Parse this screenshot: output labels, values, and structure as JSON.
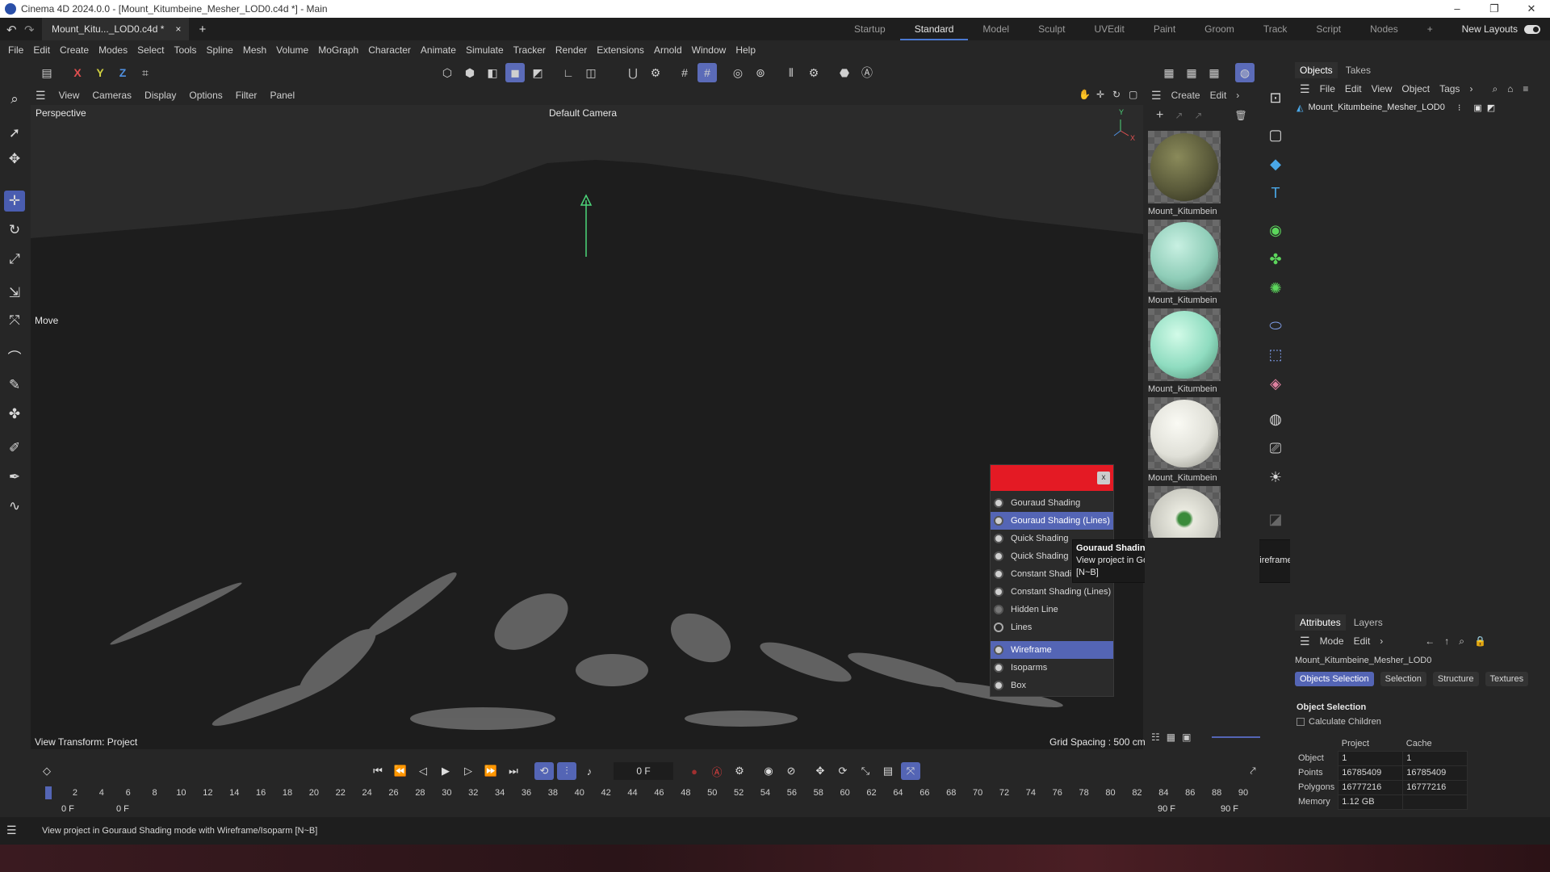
{
  "window": {
    "title": "Cinema 4D 2024.0.0 - [Mount_Kitumbeine_Mesher_LOD0.c4d *] - Main",
    "minimize": "–",
    "maximize": "❐",
    "close": "✕"
  },
  "doc_tab": {
    "label": "Mount_Kitu..._LOD0.c4d *",
    "close": "×",
    "add": "+"
  },
  "layouts": {
    "items": [
      "Startup",
      "Standard",
      "Model",
      "Sculpt",
      "UVEdit",
      "Paint",
      "Groom",
      "Track",
      "Script",
      "Nodes"
    ],
    "active": "Standard",
    "add": "+",
    "new_layouts": "New Layouts"
  },
  "menu": [
    "File",
    "Edit",
    "Create",
    "Modes",
    "Select",
    "Tools",
    "Spline",
    "Mesh",
    "Volume",
    "MoGraph",
    "Character",
    "Animate",
    "Simulate",
    "Tracker",
    "Render",
    "Extensions",
    "Arnold",
    "Window",
    "Help"
  ],
  "toolbar": {
    "axis_x": "X",
    "axis_y": "Y",
    "axis_z": "Z"
  },
  "viewport": {
    "menu": [
      "View",
      "Cameras",
      "Display",
      "Options",
      "Filter",
      "Panel"
    ],
    "projection": "Perspective",
    "camera": "Default Camera",
    "tool_label": "Move",
    "view_transform": "View Transform: Project",
    "grid_spacing": "Grid Spacing : 500 cm",
    "axis_y": "Y",
    "axis_x": "X"
  },
  "display_popup": {
    "close": "x",
    "items": [
      {
        "label": "Gouraud Shading",
        "highlight": false
      },
      {
        "label": "Gouraud Shading (Lines)",
        "highlight": true
      },
      {
        "label": "Quick Shading",
        "highlight": false
      },
      {
        "label": "Quick Shading",
        "highlight": false
      },
      {
        "label": "Constant Shadi",
        "highlight": false
      },
      {
        "label": "Constant Shading (Lines)",
        "highlight": false
      },
      {
        "label": "Hidden Line",
        "highlight": false
      },
      {
        "label": "Lines",
        "highlight": false
      }
    ],
    "items2": [
      {
        "label": "Wireframe",
        "highlight": true
      },
      {
        "label": "Isoparms",
        "highlight": false
      },
      {
        "label": "Box",
        "highlight": false
      }
    ]
  },
  "tooltip": {
    "title": "Gouraud Shading (Lines)",
    "body": "View project in Gouraud Shading  mode with Wireframe/Isoparm",
    "shortcut": "[N~B]"
  },
  "materials": {
    "menu": [
      "Create",
      "Edit"
    ],
    "items": [
      {
        "label": "Mount_Kitumbein",
        "color": "#5a5a3a"
      },
      {
        "label": "Mount_Kitumbein",
        "color": "#8fcdb8"
      },
      {
        "label": "Mount_Kitumbein",
        "color": "#8fdcc0"
      },
      {
        "label": "Mount_Kitumbein",
        "color": "#e0e0d8"
      },
      {
        "label": "",
        "color": "#eaeae0"
      }
    ]
  },
  "objects_panel": {
    "tabs": [
      "Objects",
      "Takes"
    ],
    "menu": [
      "File",
      "Edit",
      "View",
      "Object",
      "Tags"
    ],
    "object_name": "Mount_Kitumbeine_Mesher_LOD0"
  },
  "attributes": {
    "tabs": [
      "Attributes",
      "Layers"
    ],
    "menu": [
      "Mode",
      "Edit"
    ],
    "object_name": "Mount_Kitumbeine_Mesher_LOD0",
    "buttons": [
      "Objects Selection",
      "Selection",
      "Structure",
      "Textures"
    ],
    "section": "Object Selection",
    "calc_children": "Calculate Children",
    "col_project": "Project",
    "col_cache": "Cache",
    "rows": [
      {
        "label": "Object",
        "project": "1",
        "cache": "1"
      },
      {
        "label": "Points",
        "project": "16785409",
        "cache": "16785409"
      },
      {
        "label": "Polygons",
        "project": "16777216",
        "cache": "16777216"
      },
      {
        "label": "Memory",
        "project": "1.12 GB",
        "cache": ""
      }
    ]
  },
  "timeline": {
    "current_frame": "0 F",
    "ticks": [
      "0",
      "2",
      "4",
      "6",
      "8",
      "10",
      "12",
      "14",
      "16",
      "18",
      "20",
      "22",
      "24",
      "26",
      "28",
      "30",
      "32",
      "34",
      "36",
      "38",
      "40",
      "42",
      "44",
      "46",
      "48",
      "50",
      "52",
      "54",
      "56",
      "58",
      "60",
      "62",
      "64",
      "66",
      "68",
      "70",
      "72",
      "74",
      "76",
      "78",
      "80",
      "82",
      "84",
      "86",
      "88",
      "90"
    ],
    "start": "0 F",
    "start2": "0 F",
    "end": "90 F",
    "end2": "90 F"
  },
  "status": "View project in Gouraud Shading  mode with Wireframe/Isoparm [N~B]"
}
